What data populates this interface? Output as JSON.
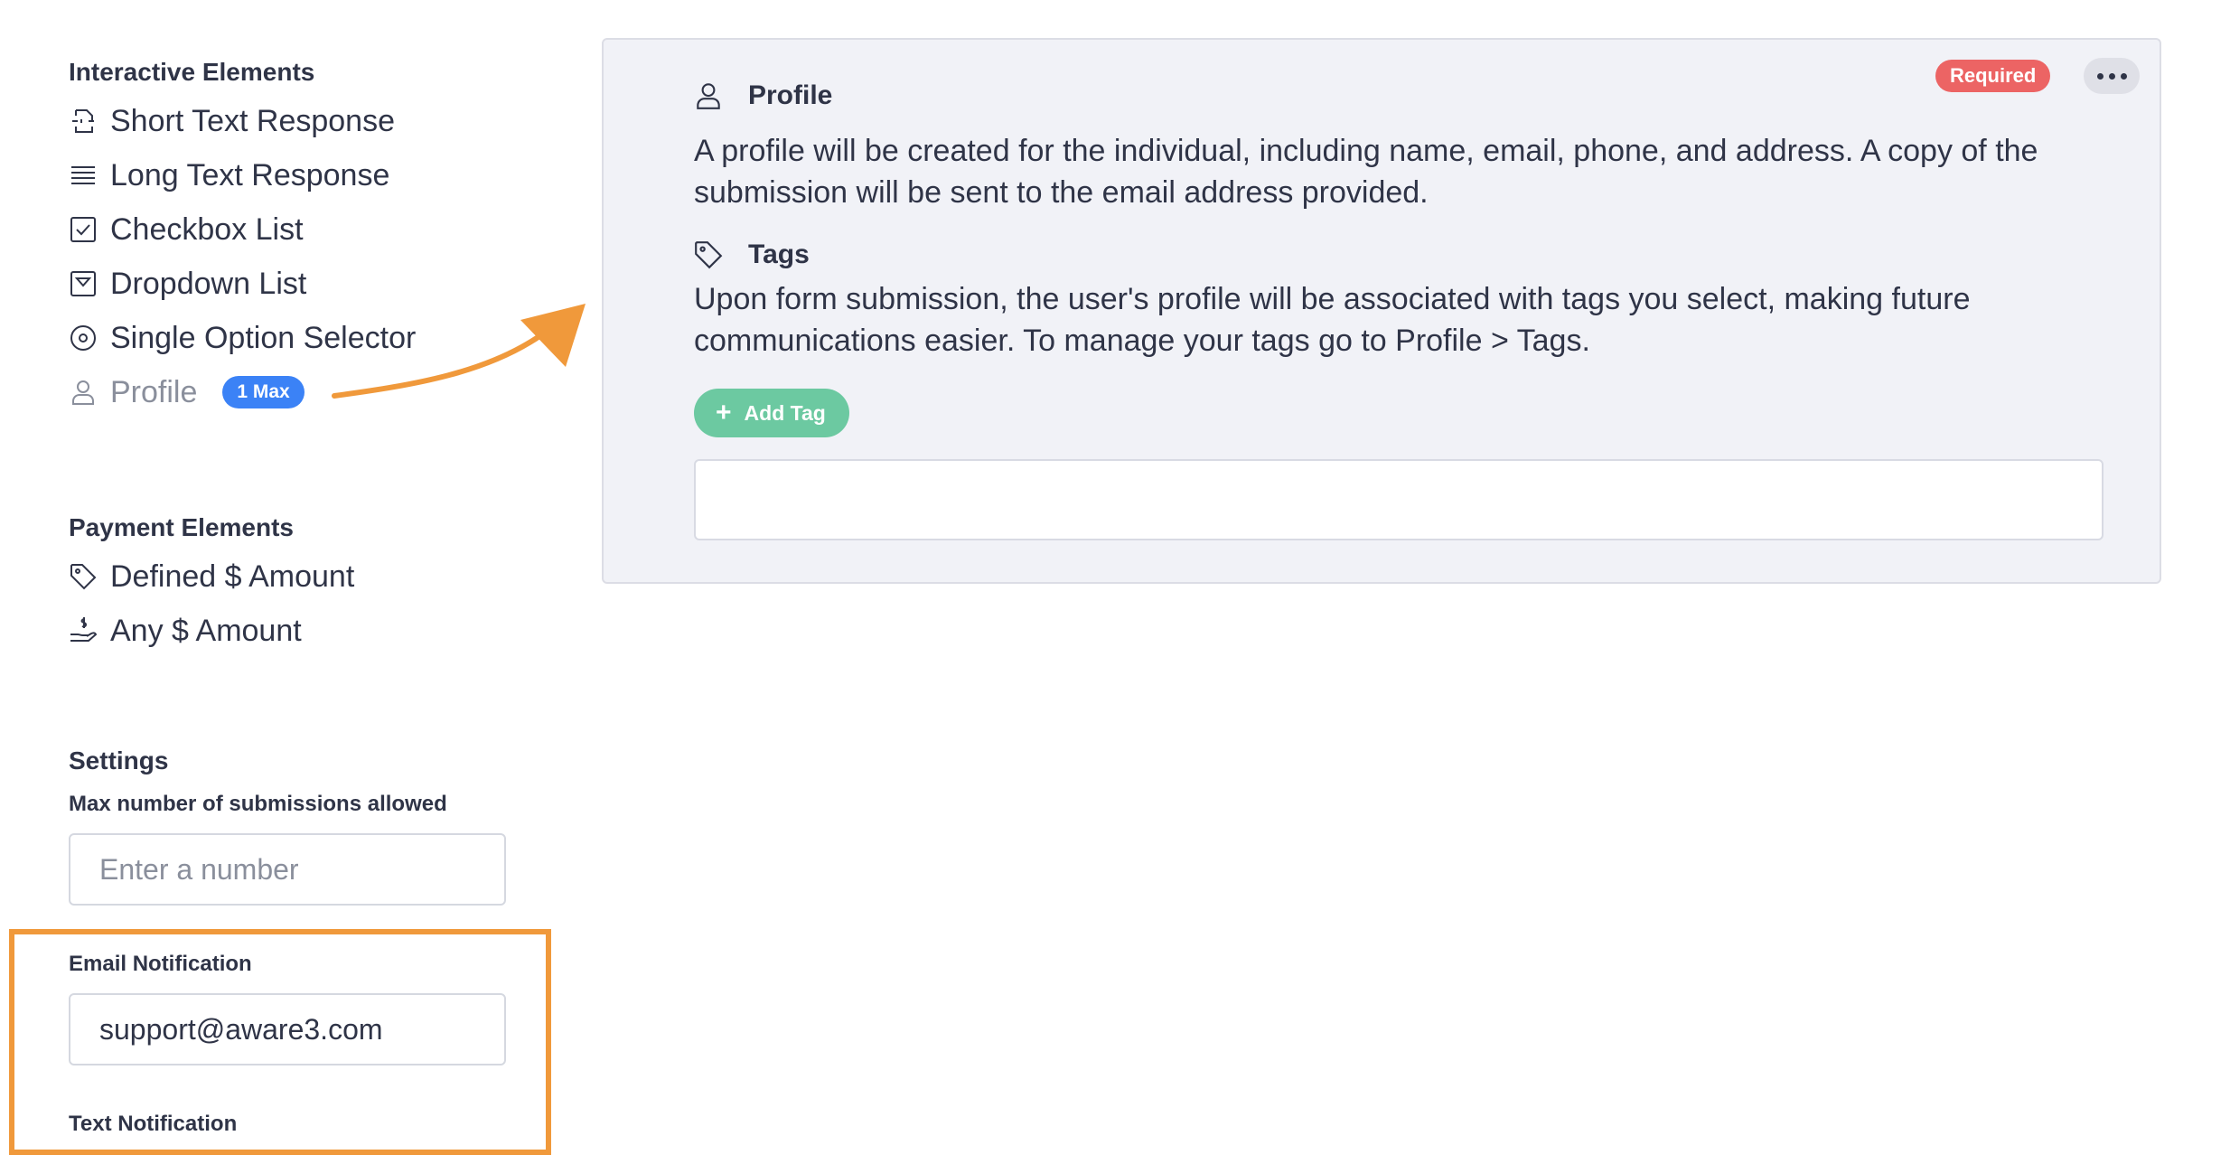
{
  "sidebar": {
    "interactive_title": "Interactive Elements",
    "interactive_items": [
      {
        "label": "Short Text Response",
        "icon": "short-text-icon"
      },
      {
        "label": "Long Text Response",
        "icon": "long-text-icon"
      },
      {
        "label": "Checkbox List",
        "icon": "checkbox-icon"
      },
      {
        "label": "Dropdown List",
        "icon": "dropdown-icon"
      },
      {
        "label": "Single Option Selector",
        "icon": "radio-icon"
      },
      {
        "label": "Profile",
        "icon": "user-icon",
        "badge": "1 Max",
        "disabled": true
      }
    ],
    "payment_title": "Payment Elements",
    "payment_items": [
      {
        "label": "Defined $ Amount",
        "icon": "tag-icon"
      },
      {
        "label": "Any $ Amount",
        "icon": "hand-dollar-icon"
      }
    ],
    "settings": {
      "title": "Settings",
      "max_submissions_label": "Max number of submissions allowed",
      "max_submissions_placeholder": "Enter a number",
      "email_label": "Email Notification",
      "email_value": "support@aware3.com",
      "text_label": "Text Notification"
    }
  },
  "card": {
    "required_badge": "Required",
    "profile_title": "Profile",
    "profile_description": "A profile will be created for the individual, including name, email, phone, and address. A copy of the submission will be sent to the email address provided.",
    "tags_title": "Tags",
    "tags_description": "Upon form submission, the user's profile will be associated with tags you select, making future communications easier. To manage your tags go to Profile > Tags.",
    "add_tag_label": "Add Tag"
  },
  "colors": {
    "highlight": "#f0993b",
    "required": "#ec6464",
    "add_tag": "#6cc9a1",
    "badge": "#3b82f6"
  }
}
